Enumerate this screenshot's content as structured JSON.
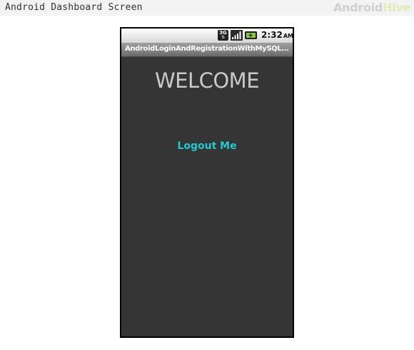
{
  "page": {
    "title": "Android Dashboard Screen",
    "brand": {
      "part1": "Android",
      "part2": "Hive"
    }
  },
  "status_bar": {
    "network_label": "3G",
    "time": "2:32",
    "ampm": "AM"
  },
  "app": {
    "title": "AndroidLoginAndRegistrationWithMySQL..."
  },
  "content": {
    "welcome": "WELCOME",
    "logout_label": "Logout Me",
    "logout_color": "#21c9cf"
  },
  "colors": {
    "screen_bg": "#353535",
    "welcome_text": "#c9c9c9"
  }
}
